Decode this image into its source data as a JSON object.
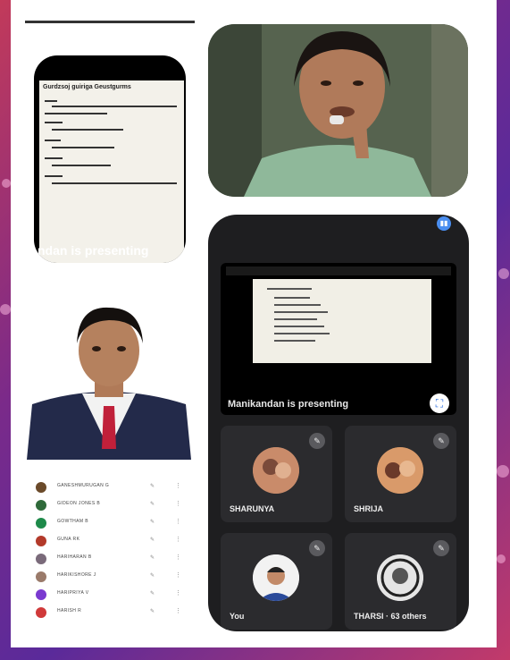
{
  "slide": {
    "title": "Gurdzsoj guiriga Geustgurms",
    "caption": "ndan is presenting"
  },
  "meet": {
    "presenting_text": "Manikandan is presenting",
    "tiles": [
      {
        "name": "SHARUNYA"
      },
      {
        "name": "SHRIJA"
      },
      {
        "name": "You"
      },
      {
        "name": "THARSI · 63 others"
      }
    ]
  },
  "participants": [
    {
      "name": "GANESHMURUGAN G",
      "color": "#6b4a2a"
    },
    {
      "name": "GIDEON JONES B",
      "color": "#2f6a3a"
    },
    {
      "name": "GOWTHAM B",
      "color": "#1e8a4a"
    },
    {
      "name": "GUNA RK",
      "color": "#b33a2a"
    },
    {
      "name": "HARIHARAN B",
      "color": "#7a6a7a"
    },
    {
      "name": "HARIKISHORE J",
      "color": "#9a7a6a"
    },
    {
      "name": "HARIPRIYA V",
      "color": "#7a3ad0"
    },
    {
      "name": "HARISH R",
      "color": "#d03a3a"
    }
  ],
  "icons": {
    "mic": "mic-off-icon",
    "more": "more-vert-icon",
    "fullscreen": "fullscreen-icon",
    "pin": "pin-icon"
  }
}
